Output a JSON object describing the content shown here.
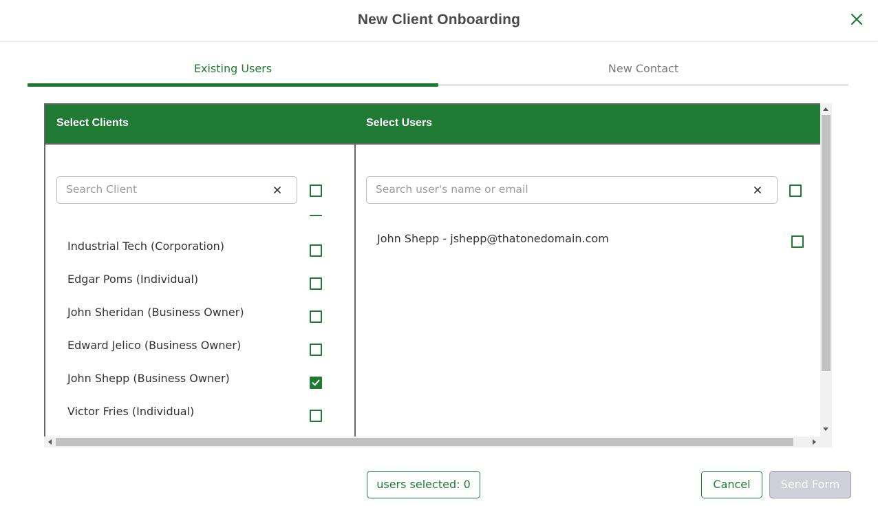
{
  "dialog": {
    "title": "New Client Onboarding"
  },
  "tabs": [
    {
      "label": "Existing Users",
      "active": true
    },
    {
      "label": "New Contact",
      "active": false
    }
  ],
  "clients_panel": {
    "header": "Select Clients",
    "search_placeholder": "Search Client",
    "search_value": "",
    "select_all_checked": false,
    "items": [
      {
        "label": "Industrial Tech (Corporation)",
        "checked": false
      },
      {
        "label": "Edgar Poms (Individual)",
        "checked": false
      },
      {
        "label": "John Sheridan (Business Owner)",
        "checked": false
      },
      {
        "label": "Edward Jelico (Business Owner)",
        "checked": false
      },
      {
        "label": "John Shepp (Business Owner)",
        "checked": true
      },
      {
        "label": "Victor Fries (Individual)",
        "checked": false
      }
    ]
  },
  "users_panel": {
    "header": "Select Users",
    "search_placeholder": "Search user's name or email",
    "search_value": "",
    "select_all_checked": false,
    "items": [
      {
        "label": "John Shepp - jshepp@thatonedomain.com",
        "checked": false
      }
    ]
  },
  "footer": {
    "users_selected": "users selected: 0",
    "cancel_label": "Cancel",
    "send_label": "Send Form",
    "send_enabled": false
  },
  "colors": {
    "accent": "#1f7a33",
    "header_text": "#4a4a4a",
    "disabled_button": "#cfd0da"
  }
}
